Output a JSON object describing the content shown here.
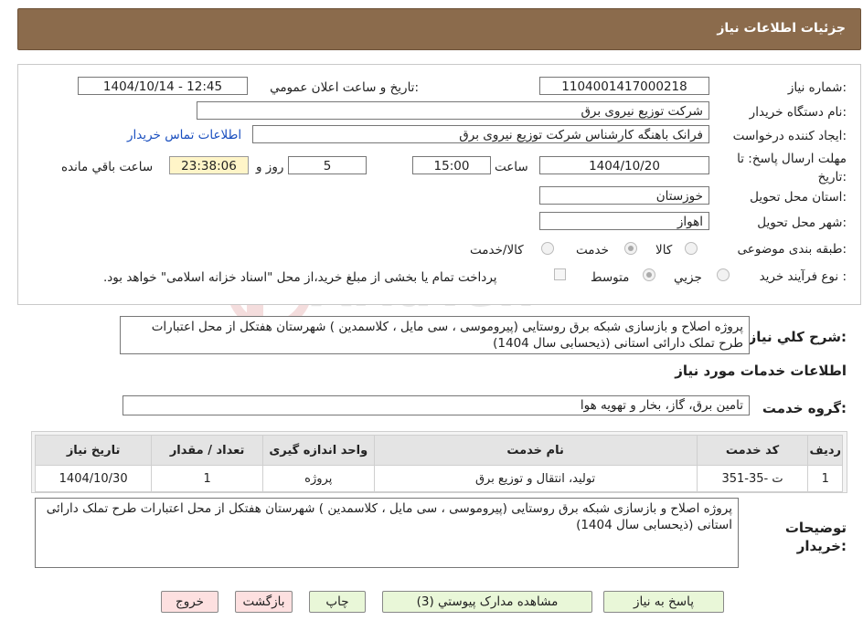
{
  "header": {
    "title": "جزئیات اطلاعات نیاز"
  },
  "form": {
    "need_number_label": "شماره نیاز:",
    "need_number": "1104001417000218",
    "announce_label": "تاریخ و ساعت اعلان عمومي:",
    "announce_value": "1404/10/14 - 12:45",
    "buyer_org_label": "نام دستگاه خريدار:",
    "buyer_org": "شرکت توزیع نیروی برق",
    "requester_label": "ايجاد کننده درخواست:",
    "requester": "فرانک  باهنگه کارشناس  شرکت توزیع نیروی برق",
    "contact_link": "اطلاعات تماس خريدار",
    "deadline_label": "مهلت ارسال پاسخ: تا تاریخ:",
    "deadline_date": "1404/10/20",
    "time_label": "ساعت",
    "deadline_time": "15:00",
    "days_value": "5",
    "days_label": "روز و",
    "remaining_time": "23:38:06",
    "remaining_label": "ساعت باقي مانده",
    "province_label": "استان محل تحویل:",
    "province": "خوزستان",
    "city_label": "شهر محل تحویل:",
    "city": "اهواز",
    "category_label": "طبقه بندی موضوعی:",
    "category_options": [
      "کالا",
      "خدمت",
      "کالا/خدمت"
    ],
    "category_selected": "خدمت",
    "process_label": "نوع فرآیند خرید :",
    "process_options": [
      "جزیي",
      "متوسط"
    ],
    "process_selected": "متوسط",
    "payment_note": "پرداخت تمام یا بخشی از مبلغ خرید،از محل \"اسناد خزانه اسلامی\" خواهد بود."
  },
  "summary": {
    "label": "شرح کلي نياز:",
    "text": "پروژه  اصلاح و بازسازی شبکه برق روستایی (پیروموسی ، سی مایل ، کلاسمدین ) شهرستان  هفتکل از محل اعتبارات طرح تملک دارائی استانی (ذیحسابی سال 1404)"
  },
  "services": {
    "section_title": "اطلاعات خدمات مورد نياز",
    "group_label": "گروه خدمت:",
    "group_value": "تامین برق، گاز، بخار و تهویه هوا",
    "columns": [
      "رديف",
      "کد خدمت",
      "نام خدمت",
      "واحد اندازه گيری",
      "تعداد / مقدار",
      "تاريخ نياز"
    ],
    "rows": [
      [
        "1",
        "ت -35-351",
        "تولید، انتقال و توزیع برق",
        "پروژه",
        "1",
        "1404/10/30"
      ]
    ]
  },
  "buyer_notes": {
    "label": "توضيحات خريدار:",
    "text": "پروژه  اصلاح و بازسازی شبکه برق روستایی (پیروموسی ، سی مایل ، کلاسمدین ) شهرستان  هفتکل از محل اعتبارات طرح تملک دارائی استانی (ذیحسابی سال 1404)"
  },
  "buttons": {
    "reply": "پاسخ به نياز",
    "attachments": "مشاهده مدارک پيوستي (3)",
    "print": "چاپ",
    "back": "بازگشت",
    "exit": "خروج"
  },
  "watermark": {
    "text": "AriaTender.neT"
  },
  "colors": {
    "header_bg": "#8b6b4c",
    "timer_bg": "#fff5c8",
    "button_bg": "#e9f7d8",
    "button_exit_bg": "#fde0e0",
    "link": "#1a4fbf"
  }
}
